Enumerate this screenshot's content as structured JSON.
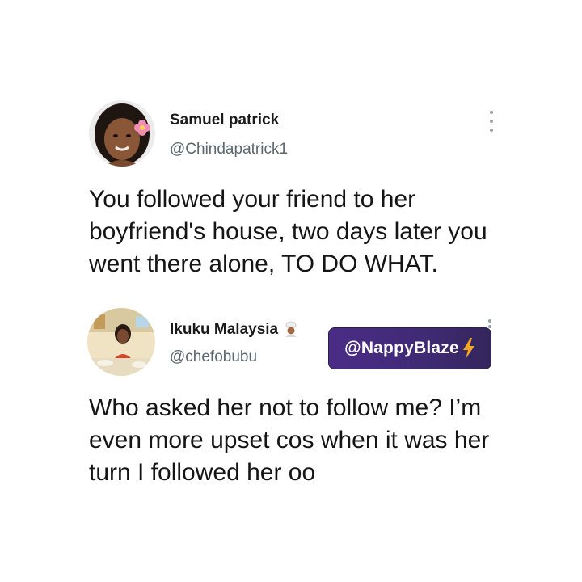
{
  "tweets": [
    {
      "display_name": "Samuel patrick",
      "handle": "@Chindapatrick1",
      "text": "You followed your friend to her boyfriend's house, two days later you went there alone, TO DO WHAT.",
      "avatar_icon": "profile-photo-woman-with-flower",
      "menu_icon": "more-vertical-icon"
    },
    {
      "display_name": "Ikuku Malaysia",
      "handle": "@chefobubu",
      "text": "Who asked her not to follow me? I’m even more upset cos when it was her turn I followed her oo",
      "avatar_icon": "profile-photo-woman-in-kitchen",
      "name_badge_icon": "chef-emoji-icon",
      "menu_icon": "more-vertical-icon"
    }
  ],
  "watermark": {
    "text": "@NappyBlaze",
    "icon": "lightning-bolt-icon",
    "background": "#442b7c",
    "bolt_color": "#f5a623"
  },
  "colors": {
    "background": "#ffffff",
    "name": "#1a1a1a",
    "handle": "#5b6770",
    "body_text": "#151515",
    "menu_dots": "#9aa3ab"
  }
}
